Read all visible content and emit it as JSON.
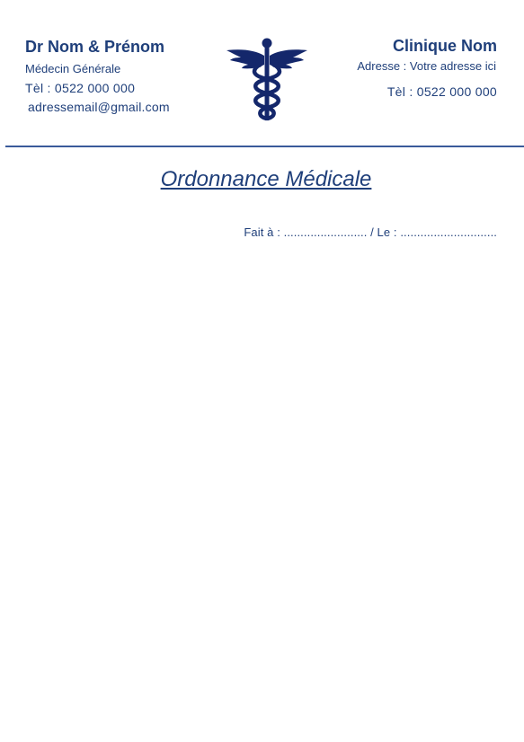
{
  "doctor": {
    "name": "Dr Nom & Prénom",
    "specialty": "Médecin Générale",
    "phone": "Tèl : 0522 000 000",
    "email": "adressemail@gmail.com"
  },
  "clinic": {
    "name": "Clinique Nom",
    "address": "Adresse : Votre adresse ici",
    "phone": "Tèl : 0522 000 000"
  },
  "logo": {
    "icon": "caduceus-icon",
    "color": "#14276b"
  },
  "document": {
    "title": "Ordonnance Médicale",
    "place_date_line": "Fait à : ......................... / Le : ............................."
  },
  "colors": {
    "primary": "#1f3f7a",
    "divider": "#3a5a9a"
  }
}
